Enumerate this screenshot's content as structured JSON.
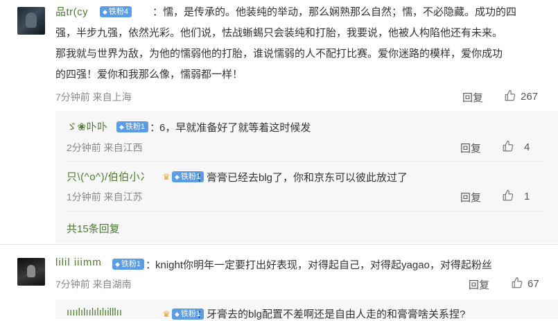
{
  "comments": [
    {
      "username": "品tr(cy",
      "badge": "铁粉4",
      "text_lines": [
        "：懦，是传承的。他装纯的举动，那么娴熟那么自然；懦，不必隐藏。成功的四",
        "强，半步九强，依然光彩。他们说，怯战蜥蜴只会装纯和打胎，我要说，他被人构陷他还有未来。",
        "那我就与世界为敌，为他的懦弱他的打胎，谁说懦弱的人不配打比赛。爱你迷路的模样，爱你成功",
        "的四强！爱你和我那么像，懦弱都一样！"
      ],
      "meta": "7分钟前 来自上海",
      "reply_label": "回复",
      "likes": "267",
      "replies": [
        {
          "username": "ゞ❀卟卟",
          "badge": "铁粉1",
          "text": "6，早就准备好了就等着这时候发",
          "meta": "2分钟前 来自江西",
          "reply_label": "回复",
          "likes": "4"
        },
        {
          "username": "只\\(^o^)/伯伯小冫",
          "badge": "铁粉1",
          "text": "膏膏已经去blg了，你和京东可以彼此放过了",
          "meta": "1分钟前 来自江苏",
          "reply_label": "回复",
          "likes": "1"
        }
      ],
      "more_replies": "共15条回复"
    },
    {
      "username": "lilil iiimm",
      "badge": "铁粉1",
      "text": "knight你明年一定要打出好表现，对得起自己，对得起yagao，对得起粉丝",
      "meta": "7分钟前 来自湖南",
      "reply_label": "回复",
      "likes": "67",
      "replies": [
        {
          "username": "ıııılılıılılılıilllıı",
          "badge": "铁粉1",
          "text": "牙膏去的blg配置不差啊还是自由人走的和膏膏啥关系捏?"
        }
      ]
    }
  ]
}
